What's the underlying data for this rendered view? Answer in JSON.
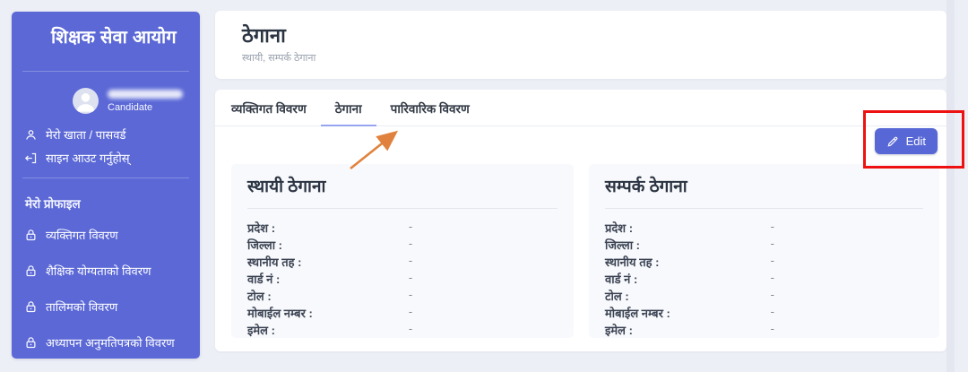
{
  "sidebar": {
    "title": "शिक्षक सेवा आयोग",
    "user": {
      "email_redacted": true,
      "role_label": "Candidate"
    },
    "account_items": [
      {
        "icon": "person-icon",
        "label": "मेरो खाता / पासवर्ड"
      },
      {
        "icon": "logout-icon",
        "label": "साइन आउट गर्नुहोस्"
      }
    ],
    "section_label": "मेरो प्रोफाइल",
    "profile_items": [
      {
        "icon": "lock-icon",
        "label": "व्यक्तिगत विवरण"
      },
      {
        "icon": "lock-icon",
        "label": "शैक्षिक योग्यताको विवरण"
      },
      {
        "icon": "lock-icon",
        "label": "तालिमको विवरण"
      },
      {
        "icon": "lock-icon",
        "label": "अध्यापन अनुमतिपत्रको विवरण"
      }
    ]
  },
  "header": {
    "title": "ठेगाना",
    "subtitle": "स्थायी, सम्पर्क ठेगाना"
  },
  "tabs": [
    {
      "label": "व्यक्तिगत विवरण",
      "active": false
    },
    {
      "label": "ठेगाना",
      "active": true
    },
    {
      "label": "पारिवारिक विवरण",
      "active": false
    }
  ],
  "edit_button": {
    "icon": "pencil-icon",
    "label": "Edit"
  },
  "panels": [
    {
      "title": "स्थायी ठेगाना",
      "fields": [
        {
          "label": "प्रदेश :",
          "value": "-"
        },
        {
          "label": "जिल्ला :",
          "value": "-"
        },
        {
          "label": "स्थानीय तह :",
          "value": "-"
        },
        {
          "label": "वार्ड नं :",
          "value": "-"
        },
        {
          "label": "टोल :",
          "value": "-"
        },
        {
          "label": "मोबाईल नम्बर :",
          "value": "-"
        },
        {
          "label": "इमेल :",
          "value": "-"
        }
      ]
    },
    {
      "title": "सम्पर्क ठेगाना",
      "fields": [
        {
          "label": "प्रदेश :",
          "value": "-"
        },
        {
          "label": "जिल्ला :",
          "value": "-"
        },
        {
          "label": "स्थानीय तह :",
          "value": "-"
        },
        {
          "label": "वार्ड नं :",
          "value": "-"
        },
        {
          "label": "टोल :",
          "value": "-"
        },
        {
          "label": "मोबाईल नम्बर :",
          "value": "-"
        },
        {
          "label": "इमेल :",
          "value": "-"
        }
      ]
    }
  ],
  "annotations": {
    "arrow_color": "#e0823d",
    "highlight_box_color": "#ed1111"
  }
}
